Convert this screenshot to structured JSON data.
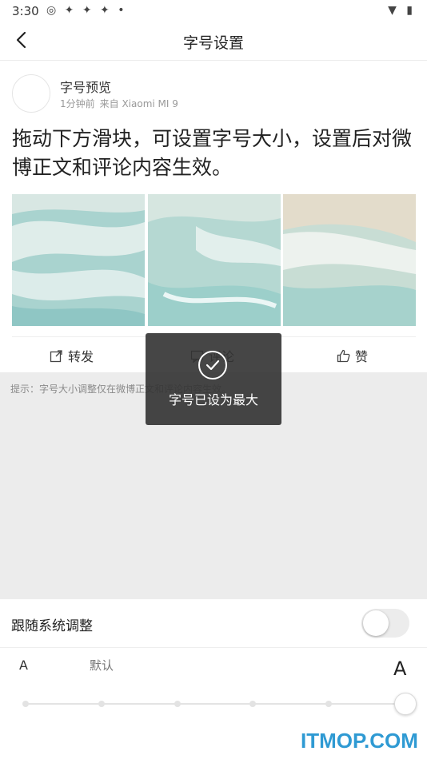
{
  "status_bar": {
    "time": "3:30",
    "icons": "◎ ✦ ✦ ✦ •",
    "right_icons": "▼ ▮"
  },
  "header": {
    "title": "字号设置"
  },
  "post": {
    "author": "字号预览",
    "time": "1分钟前",
    "source": "来自 Xiaomi MI 9",
    "text": "拖动下方滑块，可设置字号大小，设置后对微博正文和评论内容生效。"
  },
  "actions": {
    "repost": "转发",
    "comment": "评论",
    "like": "赞"
  },
  "hint": "提示：字号大小调整仅在微博正文和评论内容生效。",
  "toast": {
    "text": "字号已设为最大"
  },
  "settings": {
    "follow_system_label": "跟随系统调整",
    "follow_system_enabled": false,
    "small_a": "A",
    "default_label": "默认",
    "big_a": "A",
    "slider_steps": 6,
    "slider_value_index": 5
  },
  "watermark": "ITMOP.COM",
  "colors": {
    "gray_bg": "#ececec",
    "toast_bg": "#323232",
    "watermark": "#2f9ad3"
  }
}
